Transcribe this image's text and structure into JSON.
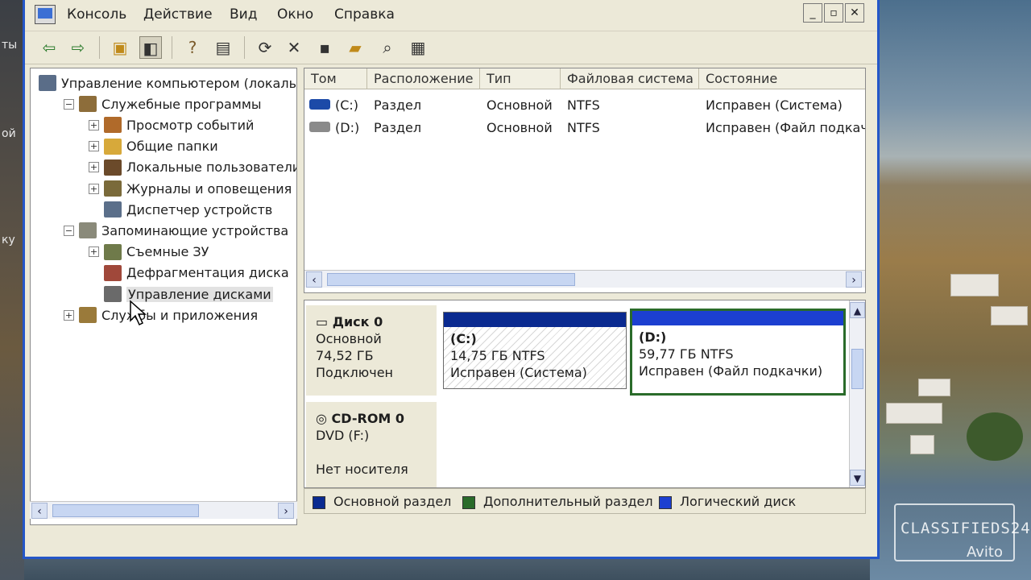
{
  "menu": [
    "Консоль",
    "Действие",
    "Вид",
    "Окно",
    "Справка"
  ],
  "window_buttons": [
    "_",
    "▫",
    "✕"
  ],
  "tree": {
    "items": [
      {
        "label": "Управление компьютером (локаль",
        "level": 0,
        "exp": "",
        "icon": "computer-icon",
        "color": "#5a6d88"
      },
      {
        "label": "Служебные программы",
        "level": 1,
        "exp": "−",
        "icon": "tools-icon",
        "color": "#8d6d3a"
      },
      {
        "label": "Просмотр событий",
        "level": 2,
        "exp": "+",
        "icon": "event-viewer-icon",
        "color": "#b06a2a"
      },
      {
        "label": "Общие папки",
        "level": 2,
        "exp": "+",
        "icon": "shared-folder-icon",
        "color": "#d7a93a"
      },
      {
        "label": "Локальные пользователи",
        "level": 2,
        "exp": "+",
        "icon": "users-icon",
        "color": "#6b4a2a"
      },
      {
        "label": "Журналы и оповещения пр",
        "level": 2,
        "exp": "+",
        "icon": "logs-icon",
        "color": "#7a6a3a"
      },
      {
        "label": "Диспетчер устройств",
        "level": 2,
        "exp": "",
        "icon": "device-manager-icon",
        "color": "#5b6f8a"
      },
      {
        "label": "Запоминающие устройства",
        "level": 1,
        "exp": "−",
        "icon": "storage-icon",
        "color": "#8a8a7a"
      },
      {
        "label": "Съемные ЗУ",
        "level": 2,
        "exp": "+",
        "icon": "removable-storage-icon",
        "color": "#6f7a4a"
      },
      {
        "label": "Дефрагментация диска",
        "level": 2,
        "exp": "",
        "icon": "defrag-icon",
        "color": "#a0483a"
      },
      {
        "label": "Управление дисками",
        "level": 2,
        "exp": "",
        "icon": "disk-management-icon",
        "color": "#6a6a6a",
        "selected": true
      },
      {
        "label": "Службы и приложения",
        "level": 1,
        "exp": "+",
        "icon": "services-icon",
        "color": "#9a7a3a"
      }
    ]
  },
  "list": {
    "columns": [
      "Том",
      "Расположение",
      "Тип",
      "Файловая система",
      "Состояние"
    ],
    "rows": [
      {
        "volume": "(C:)",
        "layout": "Раздел",
        "type": "Основной",
        "fs": "NTFS",
        "status": "Исправен (Система)",
        "icon_color": "#1c4aa8"
      },
      {
        "volume": "(D:)",
        "layout": "Раздел",
        "type": "Основной",
        "fs": "NTFS",
        "status": "Исправен (Файл подкач",
        "icon_color": "#8a8a8a"
      }
    ]
  },
  "disks": [
    {
      "name": "Диск 0",
      "type": "Основной",
      "size": "74,52 ГБ",
      "state": "Подключен",
      "partitions": [
        {
          "label": "(C:)",
          "size": "14,75 ГБ NTFS",
          "status": "Исправен (Система)"
        },
        {
          "label": "(D:)",
          "size": "59,77 ГБ NTFS",
          "status": "Исправен (Файл подкачки)"
        }
      ]
    },
    {
      "name": "CD-ROM 0",
      "type": "DVD (F:)",
      "state": "Нет носителя"
    }
  ],
  "legend": [
    {
      "label": "Основной раздел",
      "color": "#0a2a90"
    },
    {
      "label": "Дополнительный раздел",
      "color": "#2a6b2a"
    },
    {
      "label": "Логический диск",
      "color": "#1c3fd0"
    }
  ],
  "photo_overlay": {
    "left_fragments": [
      "ты",
      "ой",
      "ку"
    ],
    "watermark_line1": "CLASSIFIEDS24",
    "watermark_line2": "Avito"
  }
}
